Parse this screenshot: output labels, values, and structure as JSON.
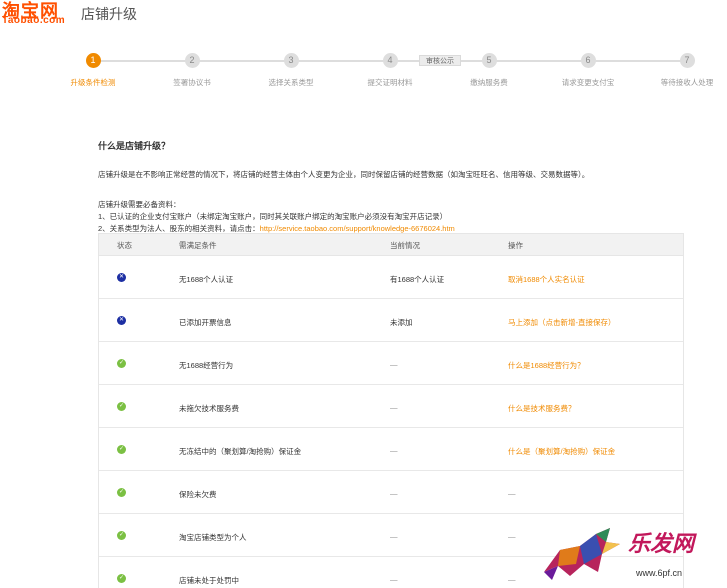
{
  "header": {
    "logo_cn": "淘宝网",
    "logo_en": "Taobao.com",
    "title": "店铺升级"
  },
  "steps": {
    "items": [
      {
        "num": "1",
        "label": "升级条件检测",
        "active": true
      },
      {
        "num": "2",
        "label": "签署协议书",
        "active": false
      },
      {
        "num": "3",
        "label": "选择关系类型",
        "active": false
      },
      {
        "num": "4",
        "label": "提交证明材料",
        "active": false
      },
      {
        "num": "5",
        "label": "缴纳服务费",
        "active": false
      },
      {
        "num": "6",
        "label": "请求变更支付宝",
        "active": false
      },
      {
        "num": "7",
        "label": "等待接收人处理",
        "active": false
      }
    ],
    "note": "审核公示"
  },
  "intro": {
    "title": "什么是店铺升级？",
    "desc": "店铺升级是在不影响正常经营的情况下，将店铺的经营主体由个人变更为企业，同时保留店铺的经营数据（如淘宝旺旺名、信用等级、交易数据等）。",
    "req_title": "店铺升级需要必备资料：",
    "req_1": "1、已认证的企业支付宝账户（未绑定淘宝账户，同时其关联账户绑定的淘宝账户必须没有淘宝开店记录）",
    "req_2_prefix": "2、关系类型为法人、股东的相关资料，请点击：",
    "req_2_link": "http://service.taobao.com/support/knowledge-6676024.htm"
  },
  "table": {
    "headers": {
      "status": "状态",
      "condition": "需满足条件",
      "current": "当前情况",
      "action": "操作"
    },
    "rows": [
      {
        "status": "fail",
        "condition": "无1688个人认证",
        "current": "有1688个人认证",
        "action": "取消1688个人实名认证"
      },
      {
        "status": "fail",
        "condition": "已添加开票信息",
        "current": "未添加",
        "action": "马上添加（点击新增-直接保存）"
      },
      {
        "status": "ok",
        "condition": "无1688经营行为",
        "current": "—",
        "action": "什么是1688经营行为？"
      },
      {
        "status": "ok",
        "condition": "未拖欠技术服务费",
        "current": "—",
        "action": "什么是技术服务费？"
      },
      {
        "status": "ok",
        "condition": "无冻结中的（聚划算/淘抢购）保证金",
        "current": "—",
        "action": "什么是（聚划算/淘抢购）保证金"
      },
      {
        "status": "ok",
        "condition": "保险未欠费",
        "current": "—",
        "action": "—"
      },
      {
        "status": "ok",
        "condition": "淘宝店铺类型为个人",
        "current": "—",
        "action": "—"
      },
      {
        "status": "ok",
        "condition": "店铺未处于处罚中",
        "current": "—",
        "action": "—"
      }
    ]
  },
  "watermark": {
    "text": "乐发网",
    "url": "www.6pf.cn"
  },
  "colors": {
    "brand": "#ff5000",
    "accent": "#f08a00",
    "fail": "#1d2fa3",
    "ok": "#7bc043"
  }
}
